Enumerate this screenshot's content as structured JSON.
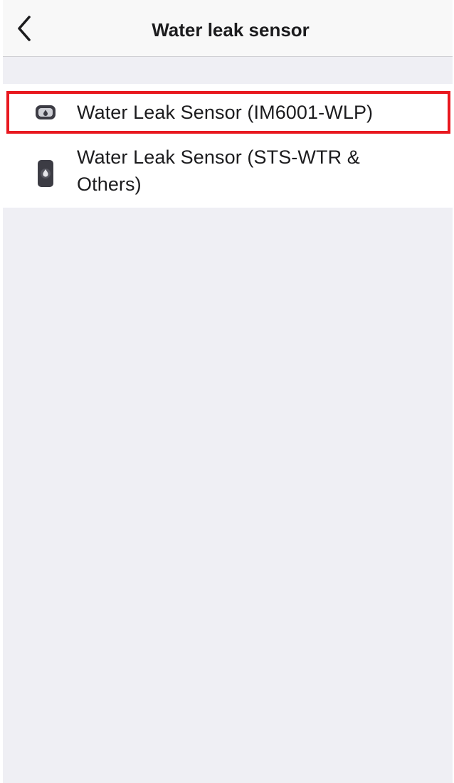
{
  "header": {
    "title": "Water leak sensor",
    "back_icon": "chevron-left-icon"
  },
  "devices": [
    {
      "label": "Water Leak Sensor (IM6001-WLP)",
      "icon": "sensor-puck-icon",
      "highlighted": true
    },
    {
      "label": "Water Leak Sensor (STS-WTR & Others)",
      "icon": "sensor-drop-icon",
      "highlighted": false
    }
  ],
  "colors": {
    "highlight": "#e8181f",
    "background": "#efeff4",
    "icon_dark": "#3c3c44"
  }
}
